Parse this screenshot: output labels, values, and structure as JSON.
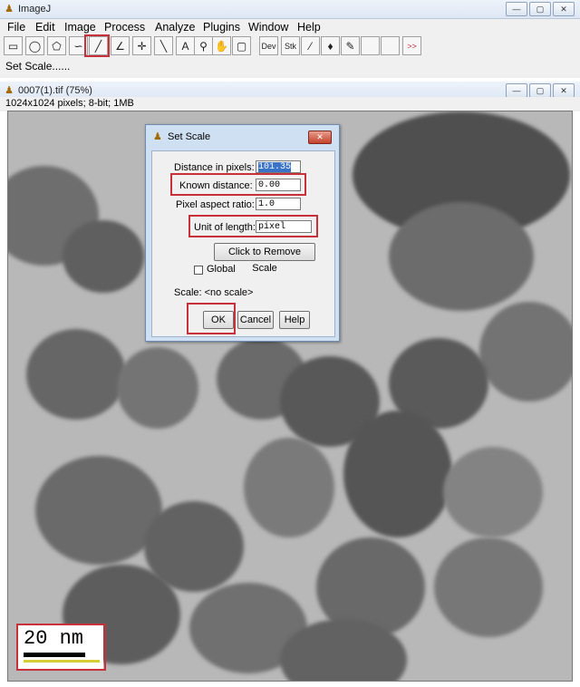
{
  "app": {
    "title": "ImageJ",
    "menu": [
      "File",
      "Edit",
      "Image",
      "Process",
      "Analyze",
      "Plugins",
      "Window",
      "Help"
    ],
    "toolbar": {
      "tools": [
        "rectangle",
        "oval",
        "polygon",
        "freehand",
        "straight-line",
        "angle",
        "point",
        "wand",
        "text",
        "magnifier",
        "hand",
        "color-picker"
      ],
      "dev_label": "Dev",
      "stk_label": "Stk",
      "more_label": ">>"
    },
    "status": "Set Scale......"
  },
  "image_window": {
    "title": "0007(1).tif (75%)",
    "info": "1024x1024 pixels; 8-bit; 1MB",
    "scale_bar_label": "20 nm"
  },
  "dialog": {
    "title": "Set Scale",
    "fields": {
      "distance_label": "Distance in pixels:",
      "distance_value": "101.35",
      "known_label": "Known distance:",
      "known_value": "0.00",
      "aspect_label": "Pixel aspect ratio:",
      "aspect_value": "1.0",
      "unit_label": "Unit of length:",
      "unit_value": "pixel"
    },
    "remove_scale_label": "Click to Remove Scale",
    "global_label": "Global",
    "scale_text": "Scale: <no scale>",
    "ok_label": "OK",
    "cancel_label": "Cancel",
    "help_label": "Help"
  },
  "colors": {
    "highlight": "#c8303a",
    "selection": "#3b73c9",
    "scale_bar_line": "#d7cd37"
  }
}
